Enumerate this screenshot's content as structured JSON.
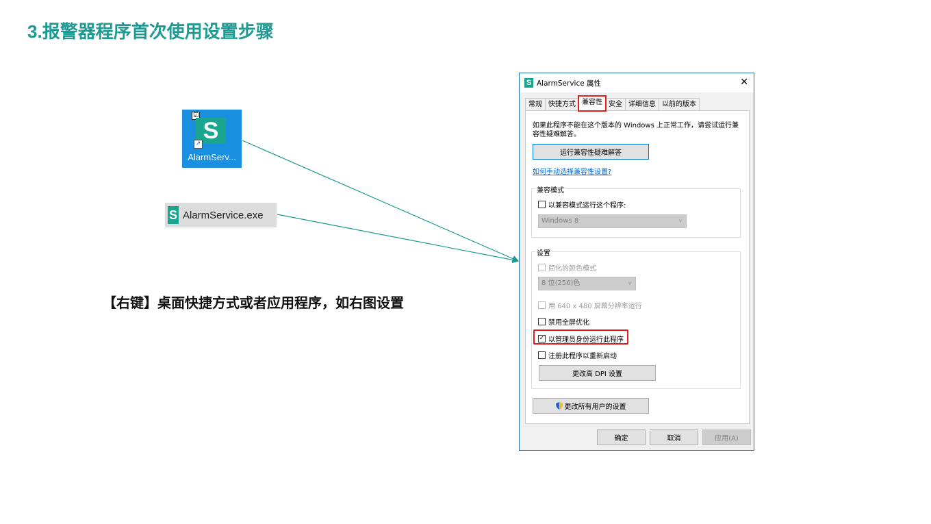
{
  "slide": {
    "number": "3.",
    "title": "报警器程序首次使用设置步骤",
    "caption": "【右键】桌面快捷方式或者应用程序，如右图设置"
  },
  "desktop_shortcut": {
    "label": "AlarmServ...",
    "logo_letter": "S",
    "check_glyph": "☑",
    "shortcut_glyph": "↗"
  },
  "exe_file": {
    "label": "AlarmService.exe",
    "logo_letter": "S"
  },
  "dialog": {
    "title": "AlarmService 属性",
    "close_glyph": "✕",
    "tabs": [
      {
        "label": "常规"
      },
      {
        "label": "快捷方式"
      },
      {
        "label": "兼容性",
        "active": true
      },
      {
        "label": "安全"
      },
      {
        "label": "详细信息"
      },
      {
        "label": "以前的版本"
      }
    ],
    "description": "如果此程序不能在这个版本的 Windows 上正常工作，请尝试运行兼容性疑难解答。",
    "run_troubleshooter_button": "运行兼容性疑难解答",
    "manual_link": "如何手动选择兼容性设置?",
    "compat_mode": {
      "group_title": "兼容模式",
      "checkbox_label": "以兼容模式运行这个程序:",
      "checked": false,
      "select_value": "Windows 8"
    },
    "settings": {
      "group_title": "设置",
      "reduced_color_label": "简化的颜色模式",
      "color_select_value": "8 位(256)色",
      "resolution_label": "用 640 x 480 屏幕分辨率运行",
      "disable_fullscreen_label": "禁用全屏优化",
      "run_as_admin_label": "以管理员身份运行此程序",
      "run_as_admin_checked": true,
      "register_restart_label": "注册此程序以重新启动",
      "dpi_button": "更改高 DPI 设置"
    },
    "all_users_button": "更改所有用户的设置",
    "ok_button": "确定",
    "cancel_button": "取消",
    "apply_button": "应用(A)",
    "check_glyph": "✓",
    "caret_glyph": "∨"
  },
  "colors": {
    "title_teal": "#1e9a92",
    "arrow_teal": "#1a9a8e",
    "highlight_red": "#e02020",
    "desktop_blue": "#1a8fe0",
    "logo_green": "#1aa58e"
  }
}
